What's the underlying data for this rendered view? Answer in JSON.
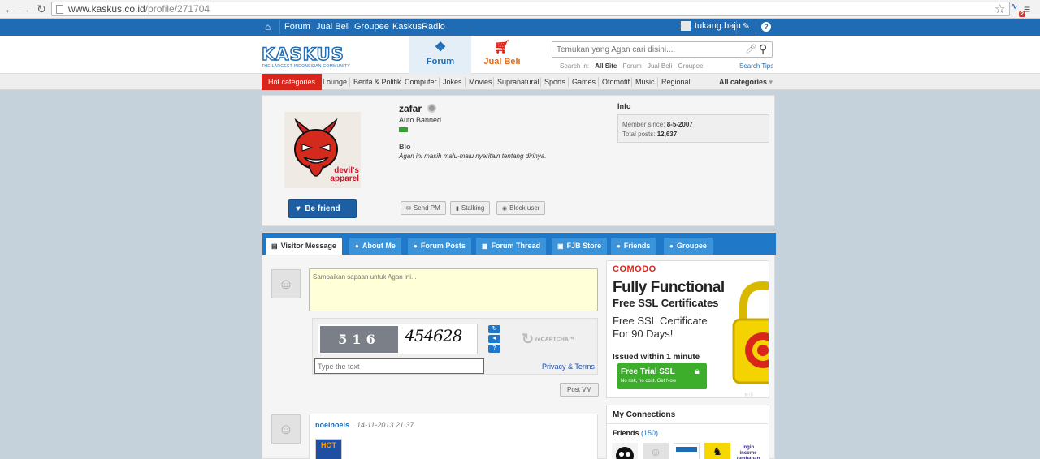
{
  "browser": {
    "url_host": "www.kaskus.co.id",
    "url_path": "/profile/271704",
    "extension_badge": "2"
  },
  "topbar": {
    "links": [
      "Forum",
      "Jual Beli",
      "Groupee",
      "KaskusRadio"
    ],
    "username": "tukang.baju"
  },
  "header": {
    "logo_text": "KASKUS",
    "logo_tagline": "THE LARGEST INDONESIAN COMMUNITY",
    "tab_forum": "Forum",
    "tab_jualbeli": "Jual Beli",
    "search_placeholder": "Temukan yang Agan cari disini....",
    "search_in_label": "Search in:",
    "search_options": [
      "All Site",
      "Forum",
      "Jual Beli",
      "Groupee"
    ],
    "search_tips": "Search Tips"
  },
  "categories": {
    "hot": "Hot categories",
    "items": [
      "Lounge",
      "Berita & Politik",
      "Computer",
      "Jokes",
      "Movies",
      "Supranatural",
      "Sports",
      "Games",
      "Otomotif",
      "Music",
      "Regional"
    ],
    "all": "All categories"
  },
  "profile": {
    "avatar_caption": "devil's apparel",
    "username": "zafar",
    "rank": "Auto Banned",
    "bio_label": "Bio",
    "bio_text": "Agan ini masih malu-malu nyeritain tentang dirinya.",
    "be_friend": "Be friend",
    "buttons": [
      "Send PM",
      "Stalking",
      "Block user"
    ],
    "info_label": "Info",
    "member_since_label": "Member since:",
    "member_since": "8-5-2007",
    "total_posts_label": "Total posts:",
    "total_posts": "12,637"
  },
  "tabs": [
    "Visitor Message",
    "About Me",
    "Forum Posts",
    "Forum Thread",
    "FJB Store",
    "Friends",
    "Groupee"
  ],
  "visitor_message": {
    "placeholder": "Sampaikan sapaan untuk Agan ini...",
    "captcha_photo_text": "516",
    "captcha_word": "454628",
    "captcha_input_placeholder": "Type the text",
    "recaptcha_label": "reCAPTCHA™",
    "privacy": "Privacy & Terms",
    "post_button": "Post VM",
    "entry": {
      "author": "noelnoels",
      "date": "14-11-2013 21:37"
    }
  },
  "ad": {
    "brand": "COMODO",
    "headline1": "Fully Functional",
    "headline2": "Free SSL Certificates",
    "text1": "Free SSL Certificate",
    "text2": "For 90 Days!",
    "issued": "Issued within 1 minute",
    "btn_main": "Free Trial SSL",
    "btn_sub": "No risk, no cost. Get Now"
  },
  "connections": {
    "title": "My Connections",
    "friends_label": "Friends",
    "friends_count": "(150)",
    "thumb_text": "ingin income tambahan"
  }
}
